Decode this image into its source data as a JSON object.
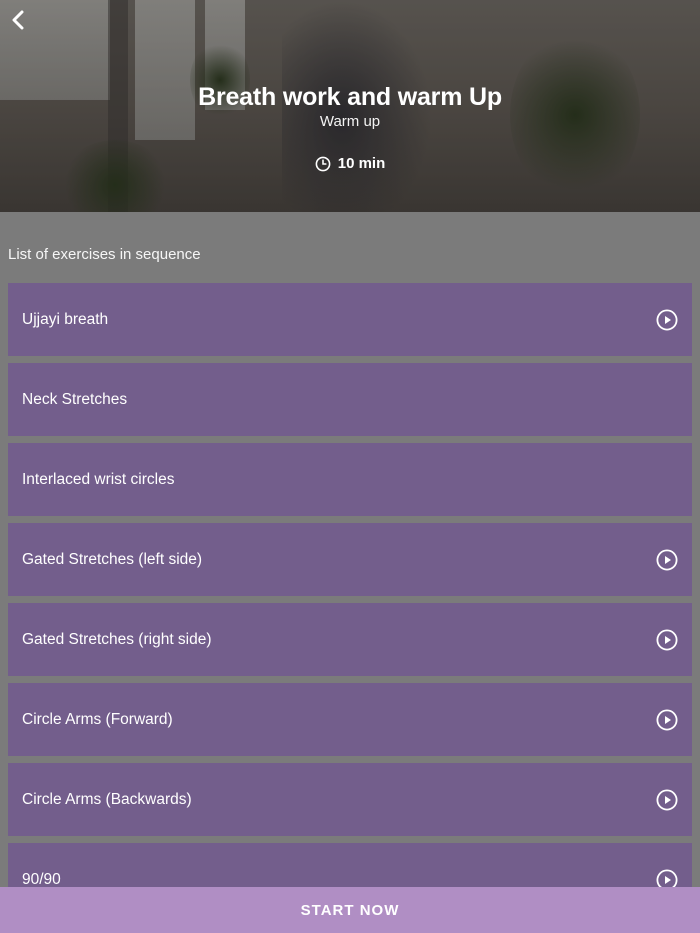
{
  "header": {
    "title": "Breath work and warm Up",
    "subtitle": "Warm up",
    "duration": "10 min",
    "back_icon": "chevron-left-icon",
    "clock_icon": "clock-icon"
  },
  "list": {
    "caption": "List of exercises in sequence",
    "items": [
      {
        "label": "Ujjayi breath",
        "has_play": true
      },
      {
        "label": "Neck Stretches",
        "has_play": false
      },
      {
        "label": "Interlaced wrist circles",
        "has_play": false
      },
      {
        "label": "Gated Stretches (left side)",
        "has_play": true
      },
      {
        "label": "Gated Stretches (right side)",
        "has_play": true
      },
      {
        "label": "Circle Arms (Forward)",
        "has_play": true
      },
      {
        "label": "Circle Arms (Backwards)",
        "has_play": true
      },
      {
        "label": "90/90",
        "has_play": true
      }
    ]
  },
  "footer": {
    "start_label": "START NOW"
  },
  "colors": {
    "background": "#7b7b7b",
    "list_item": "#735e8c",
    "start_button": "#b08ec4",
    "text": "#ffffff"
  }
}
